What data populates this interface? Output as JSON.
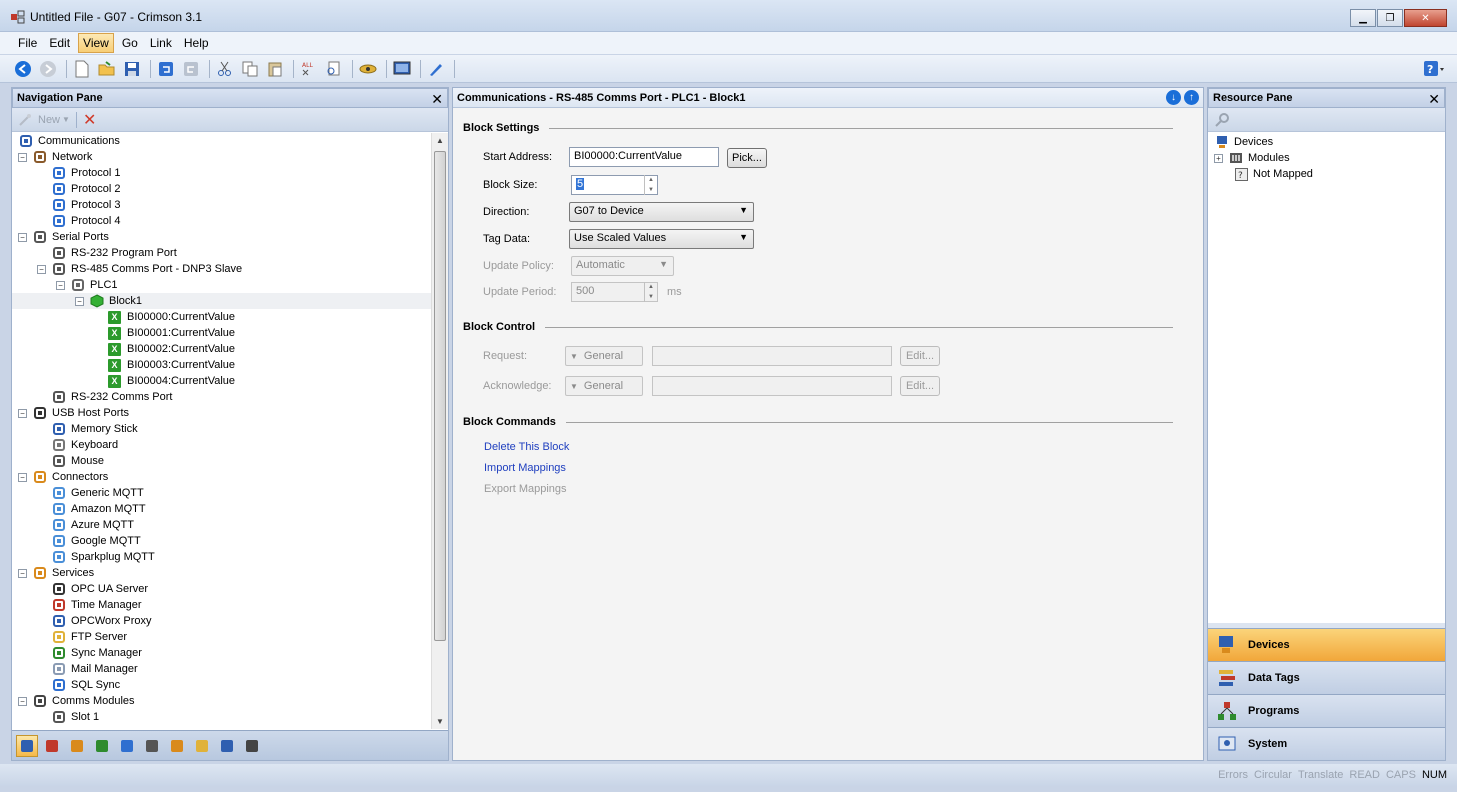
{
  "window": {
    "title": "Untitled File - G07 - Crimson 3.1"
  },
  "menu": [
    "File",
    "Edit",
    "View",
    "Go",
    "Link",
    "Help"
  ],
  "toolbar": {
    "icons": [
      "back-icon",
      "forward-icon",
      "new-file-icon",
      "open-folder-icon",
      "save-icon",
      "undo-icon",
      "redo-icon",
      "cut-icon",
      "copy-icon",
      "paste-icon",
      "find-all-icon",
      "replace-icon",
      "link-icon",
      "screen-icon",
      "pen-icon",
      "help-icon"
    ]
  },
  "nav_pane": {
    "title": "Navigation Pane",
    "new_label": "New",
    "tree": [
      {
        "label": "Communications",
        "level": 0,
        "expander": "",
        "icon": "communications-icon"
      },
      {
        "label": "Network",
        "level": 0,
        "expander": "−",
        "icon": "network-icon"
      },
      {
        "label": "Protocol 1",
        "level": 1,
        "expander": "",
        "icon": "protocol-icon"
      },
      {
        "label": "Protocol 2",
        "level": 1,
        "expander": "",
        "icon": "protocol-icon"
      },
      {
        "label": "Protocol 3",
        "level": 1,
        "expander": "",
        "icon": "protocol-icon"
      },
      {
        "label": "Protocol 4",
        "level": 1,
        "expander": "",
        "icon": "protocol-icon"
      },
      {
        "label": "Serial Ports",
        "level": 0,
        "expander": "−",
        "icon": "serial-port-icon"
      },
      {
        "label": "RS-232 Program Port",
        "level": 1,
        "expander": "",
        "icon": "serial-port-icon"
      },
      {
        "label": "RS-485 Comms Port - DNP3 Slave",
        "level": 1,
        "expander": "−",
        "icon": "serial-port-icon"
      },
      {
        "label": "PLC1",
        "level": 2,
        "expander": "−",
        "icon": "plc-icon"
      },
      {
        "label": "Block1",
        "level": 3,
        "expander": "−",
        "icon": "block-icon",
        "selected": true
      },
      {
        "label": "BI00000:CurrentValue",
        "level": 4,
        "expander": "",
        "icon": "mapping-icon"
      },
      {
        "label": "BI00001:CurrentValue",
        "level": 4,
        "expander": "",
        "icon": "mapping-icon"
      },
      {
        "label": "BI00002:CurrentValue",
        "level": 4,
        "expander": "",
        "icon": "mapping-icon"
      },
      {
        "label": "BI00003:CurrentValue",
        "level": 4,
        "expander": "",
        "icon": "mapping-icon"
      },
      {
        "label": "BI00004:CurrentValue",
        "level": 4,
        "expander": "",
        "icon": "mapping-icon"
      },
      {
        "label": "RS-232 Comms Port",
        "level": 1,
        "expander": "",
        "icon": "serial-port-icon"
      },
      {
        "label": "USB Host Ports",
        "level": 0,
        "expander": "−",
        "icon": "usb-icon"
      },
      {
        "label": "Memory Stick",
        "level": 1,
        "expander": "",
        "icon": "memory-stick-icon"
      },
      {
        "label": "Keyboard",
        "level": 1,
        "expander": "",
        "icon": "keyboard-icon"
      },
      {
        "label": "Mouse",
        "level": 1,
        "expander": "",
        "icon": "mouse-icon"
      },
      {
        "label": "Connectors",
        "level": 0,
        "expander": "−",
        "icon": "connectors-icon"
      },
      {
        "label": "Generic MQTT",
        "level": 1,
        "expander": "",
        "icon": "cloud-icon"
      },
      {
        "label": "Amazon MQTT",
        "level": 1,
        "expander": "",
        "icon": "cloud-icon"
      },
      {
        "label": "Azure MQTT",
        "level": 1,
        "expander": "",
        "icon": "cloud-icon"
      },
      {
        "label": "Google MQTT",
        "level": 1,
        "expander": "",
        "icon": "cloud-icon"
      },
      {
        "label": "Sparkplug MQTT",
        "level": 1,
        "expander": "",
        "icon": "cloud-icon"
      },
      {
        "label": "Services",
        "level": 0,
        "expander": "−",
        "icon": "services-icon"
      },
      {
        "label": "OPC UA Server",
        "level": 1,
        "expander": "",
        "icon": "opc-ua-icon"
      },
      {
        "label": "Time Manager",
        "level": 1,
        "expander": "",
        "icon": "clock-icon"
      },
      {
        "label": "OPCWorx Proxy",
        "level": 1,
        "expander": "",
        "icon": "proxy-icon"
      },
      {
        "label": "FTP Server",
        "level": 1,
        "expander": "",
        "icon": "ftp-icon"
      },
      {
        "label": "Sync Manager",
        "level": 1,
        "expander": "",
        "icon": "sync-icon"
      },
      {
        "label": "Mail Manager",
        "level": 1,
        "expander": "",
        "icon": "mail-icon"
      },
      {
        "label": "SQL Sync",
        "level": 1,
        "expander": "",
        "icon": "sql-icon"
      },
      {
        "label": "Comms Modules",
        "level": 0,
        "expander": "−",
        "icon": "modules-icon"
      },
      {
        "label": "Slot 1",
        "level": 1,
        "expander": "",
        "icon": "slot-icon"
      }
    ],
    "categories": [
      "communications-icon",
      "data-tags-icon",
      "devices-icon",
      "programs-icon",
      "web-server-icon",
      "display-icon",
      "security-icon",
      "database-icon",
      "network-icon",
      "memory-icon"
    ]
  },
  "center": {
    "title": "Communications - RS-485 Comms Port - PLC1 - Block1",
    "block_settings": {
      "title": "Block Settings",
      "start_address_label": "Start Address:",
      "start_address_value": "BI00000:CurrentValue",
      "pick_button": "Pick...",
      "block_size_label": "Block Size:",
      "block_size_value": "5",
      "direction_label": "Direction:",
      "direction_value": "G07 to Device",
      "tag_data_label": "Tag Data:",
      "tag_data_value": "Use Scaled Values",
      "update_policy_label": "Update Policy:",
      "update_policy_value": "Automatic",
      "update_period_label": "Update Period:",
      "update_period_value": "500",
      "update_period_unit": "ms"
    },
    "block_control": {
      "title": "Block Control",
      "request_label": "Request:",
      "request_combo": "General",
      "request_edit": "Edit...",
      "acknowledge_label": "Acknowledge:",
      "acknowledge_combo": "General",
      "acknowledge_edit": "Edit..."
    },
    "block_commands": {
      "title": "Block Commands",
      "delete": "Delete This Block",
      "import": "Import Mappings",
      "export": "Export Mappings"
    }
  },
  "resource_pane": {
    "title": "Resource Pane",
    "tree": [
      {
        "label": "Devices",
        "level": 0,
        "expander": ""
      },
      {
        "label": "Modules",
        "level": 1,
        "expander": "+"
      },
      {
        "label": "Not Mapped",
        "level": 1,
        "expander": ""
      }
    ],
    "categories": [
      {
        "label": "Devices",
        "active": true
      },
      {
        "label": "Data Tags",
        "active": false
      },
      {
        "label": "Programs",
        "active": false
      },
      {
        "label": "System",
        "active": false
      }
    ]
  },
  "status": {
    "items": [
      {
        "label": "Errors",
        "on": false
      },
      {
        "label": "Circular",
        "on": false
      },
      {
        "label": "Translate",
        "on": false
      },
      {
        "label": "READ",
        "on": false
      },
      {
        "label": "CAPS",
        "on": false
      },
      {
        "label": "NUM",
        "on": true
      }
    ]
  }
}
